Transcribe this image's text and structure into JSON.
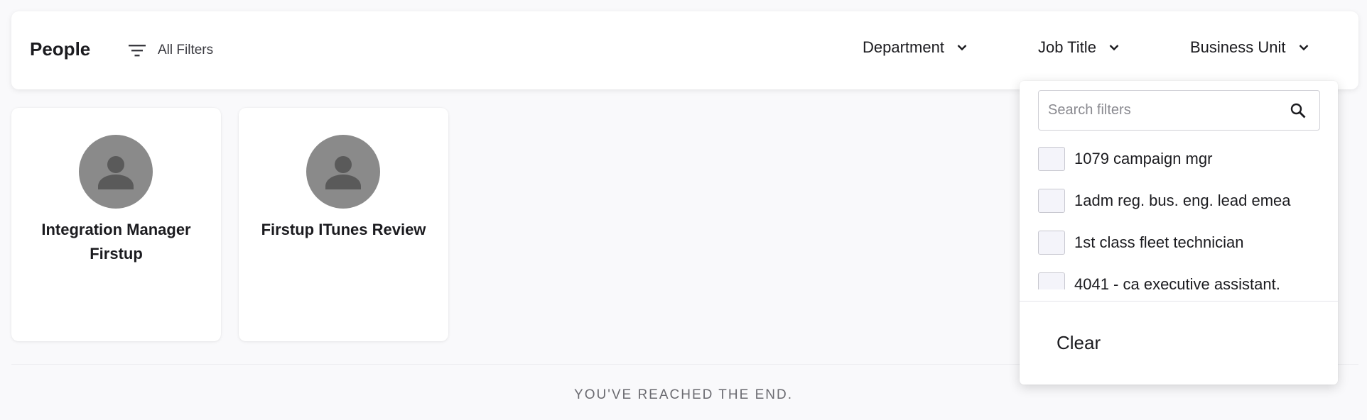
{
  "header": {
    "title": "People",
    "all_filters_label": "All Filters",
    "filters": [
      {
        "label": "Department",
        "icon": "chevron-down-icon"
      },
      {
        "label": "Job Title",
        "icon": "chevron-down-icon"
      },
      {
        "label": "Business Unit",
        "icon": "chevron-down-icon"
      }
    ]
  },
  "people": [
    {
      "name": "Integration Manager Firstup",
      "avatar": "person-icon"
    },
    {
      "name": "Firstup ITunes Review",
      "avatar": "person-icon"
    }
  ],
  "footer": {
    "end_text": "YOU'VE REACHED THE END."
  },
  "filter_dropdown": {
    "search_placeholder": "Search filters",
    "search_value": "",
    "options": [
      {
        "label": "1079 campaign mgr",
        "checked": false
      },
      {
        "label": "1adm reg. bus. eng. lead emea",
        "checked": false
      },
      {
        "label": "1st class fleet technician",
        "checked": false
      },
      {
        "label": "4041 - ca executive assistant,",
        "checked": false
      }
    ],
    "clear_label": "Clear"
  },
  "colors": {
    "background": "#f9f9fb",
    "card": "#ffffff",
    "avatar": "#8a8a8a",
    "text": "#1b1b1f",
    "muted_text": "#6a6a70"
  }
}
